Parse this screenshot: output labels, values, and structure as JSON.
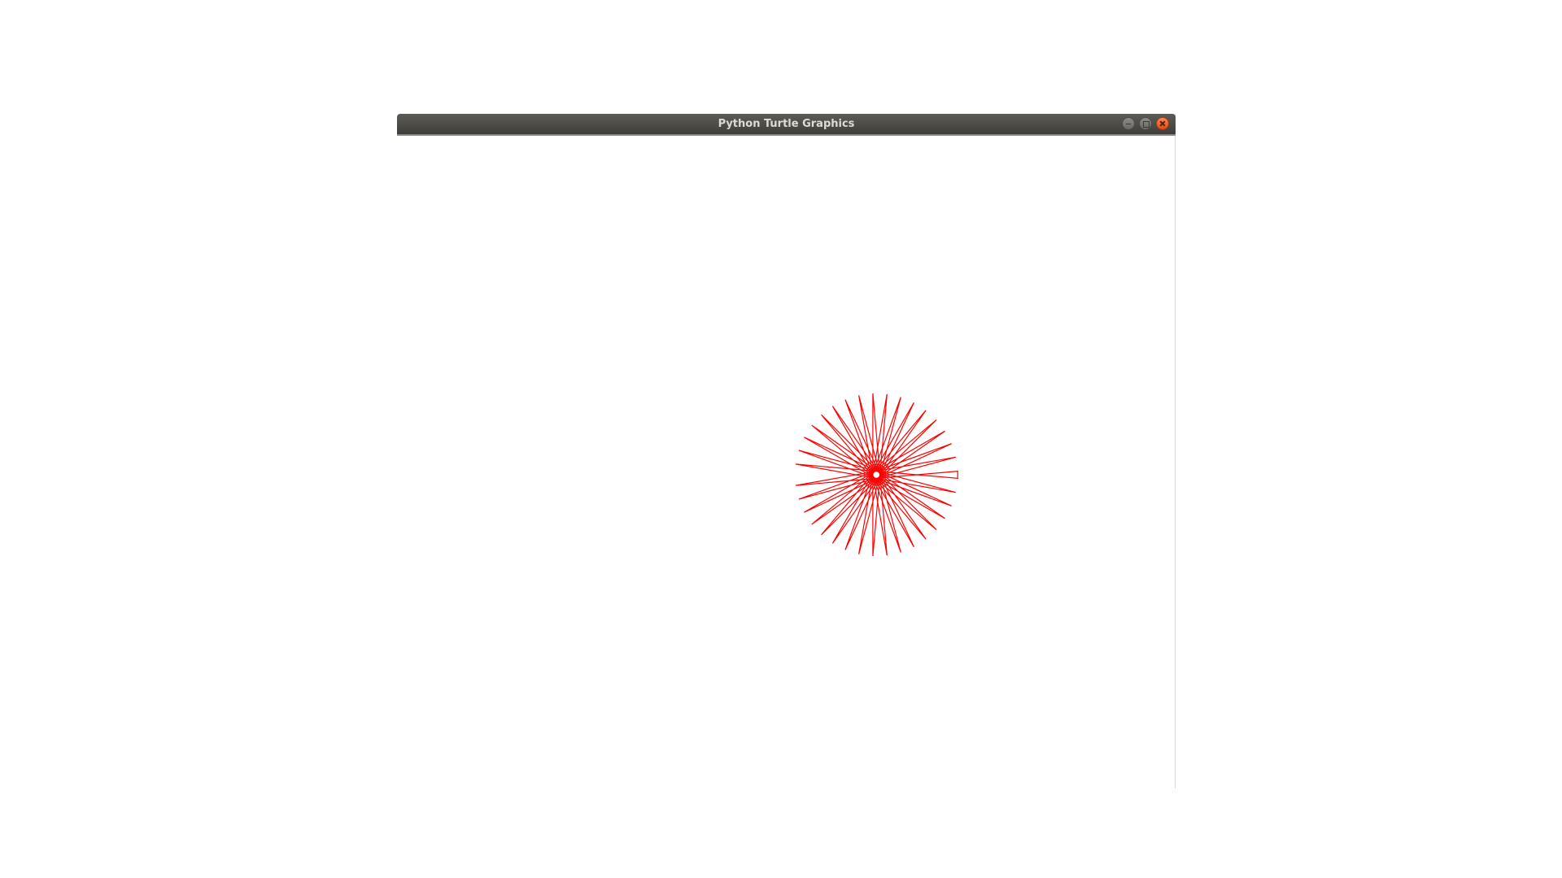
{
  "window": {
    "title": "Python Turtle Graphics",
    "controls": [
      "minimize",
      "maximize",
      "close"
    ]
  },
  "drawing": {
    "shape": "star",
    "points": 36,
    "pen_color": "#ff0000",
    "background": "#ffffff"
  }
}
